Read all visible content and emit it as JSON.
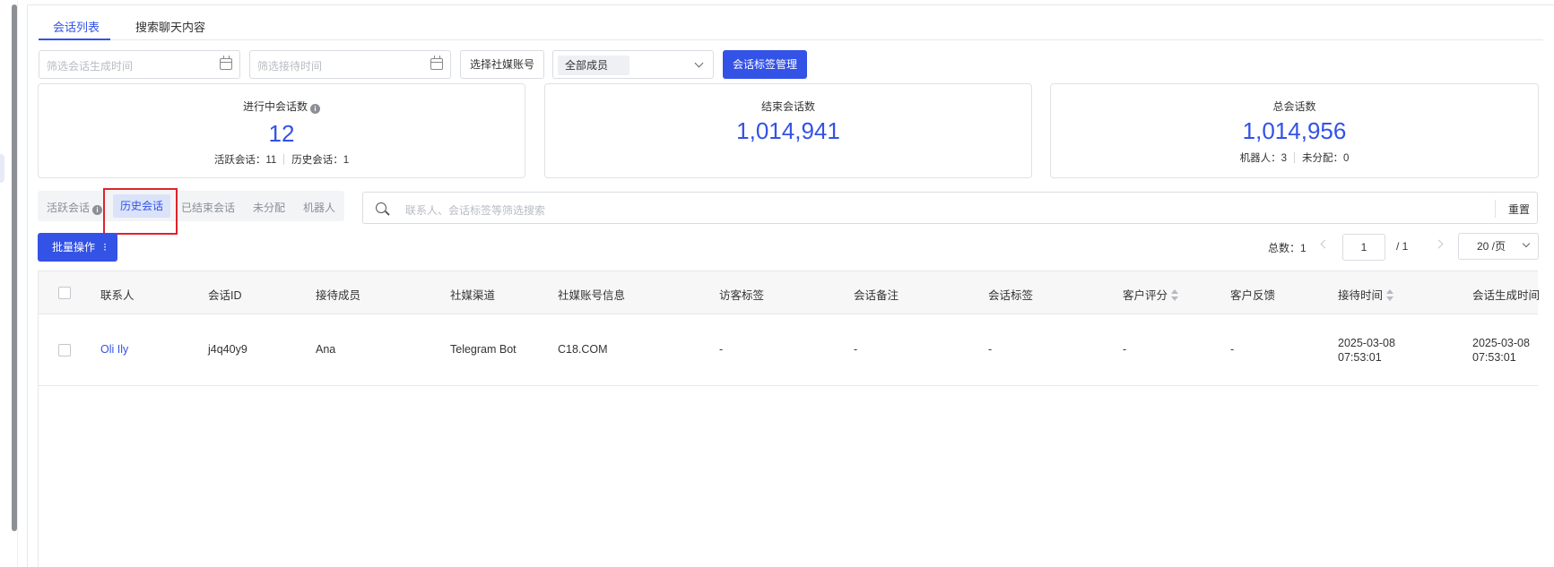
{
  "tabs": [
    {
      "label": "会话列表",
      "active": true
    },
    {
      "label": "搜索聊天内容",
      "active": false
    }
  ],
  "filters": {
    "created_time_placeholder": "筛选会话生成时间",
    "reception_time_placeholder": "筛选接待时间",
    "social_account_button": "选择社媒账号",
    "members_select_value": "全部成员",
    "tag_manage_button": "会话标签管理"
  },
  "stats": {
    "ongoing": {
      "title": "进行中会话数",
      "value": "12",
      "active_label": "活跃会话：11",
      "history_label": "历史会话：1"
    },
    "ended": {
      "title": "结束会话数",
      "value": "1,014,941"
    },
    "total": {
      "title": "总会话数",
      "value": "1,014,956",
      "robot_label": "机器人：3",
      "unassigned_label": "未分配：0"
    }
  },
  "segments": {
    "active": "活跃会话",
    "history": "历史会话",
    "ended": "已结束会话",
    "unassigned": "未分配",
    "robot": "机器人",
    "selected": "历史会话"
  },
  "search": {
    "placeholder": "联系人、会话标签等筛选搜索",
    "reset_label": "重置"
  },
  "batch": {
    "label": "批量操作",
    "dots": "⁝"
  },
  "pagination": {
    "total_label": "总数：1",
    "current_page": "1",
    "of_label": "/  1",
    "page_size": "20 /页"
  },
  "table": {
    "headers": {
      "contact": "联系人",
      "session_id": "会话ID",
      "agent": "接待成员",
      "channel": "社媒渠道",
      "account_info": "社媒账号信息",
      "visitor_tags": "访客标签",
      "session_note": "会话备注",
      "session_tags": "会话标签",
      "rating": "客户评分",
      "feedback": "客户反馈",
      "reception_time": "接待时间",
      "created_time": "会话生成时间"
    },
    "rows": [
      {
        "contact": "Oli Ily",
        "session_id": "j4q40y9",
        "agent": "Ana",
        "channel": "Telegram Bot",
        "account_info": "C18.COM",
        "visitor_tags": "-",
        "session_note": "-",
        "session_tags": "-",
        "rating": "-",
        "feedback": "-",
        "reception_date": "2025-03-08",
        "reception_clock": "07:53:01",
        "created_date": "2025-03-08",
        "created_clock": "07:53:01"
      }
    ]
  },
  "colors": {
    "accent": "#3352e6",
    "highlight_border": "#e0222a",
    "segment_selected_bg": "#dbe3fb"
  }
}
